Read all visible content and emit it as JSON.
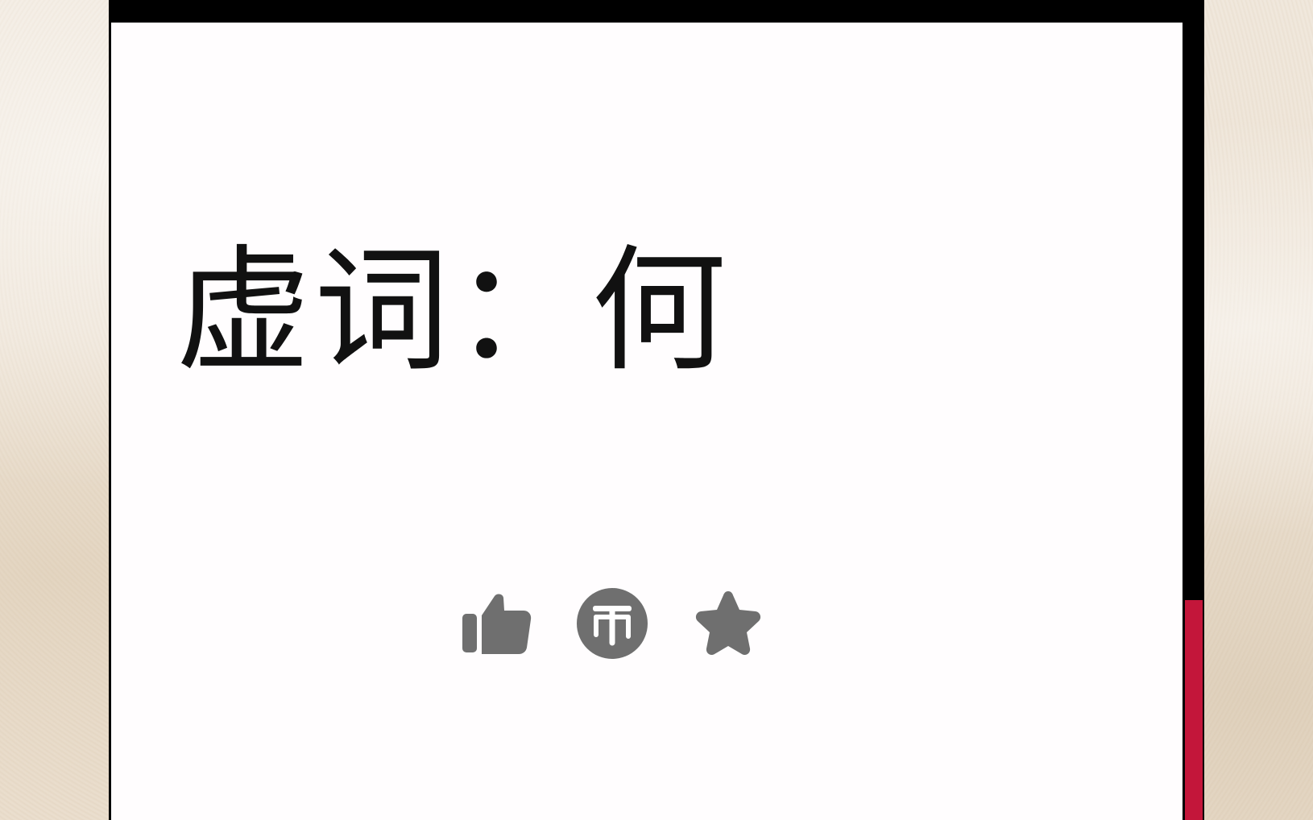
{
  "video": {
    "title": "虚词：何"
  },
  "actions": {
    "like_icon": "thumbs-up-icon",
    "coin_icon": "coin-icon",
    "favorite_icon": "star-icon",
    "coin_glyph": "币"
  },
  "colors": {
    "icon_gray": "#6f6f6f",
    "accent_red": "#c3163a",
    "frame_black": "#000000",
    "card_white": "#fffdfe"
  }
}
